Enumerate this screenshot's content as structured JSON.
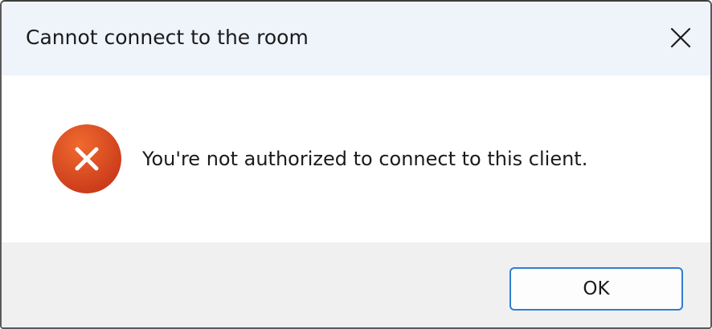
{
  "dialog": {
    "title": "Cannot connect to the room",
    "message": "You're not authorized to connect to this client.",
    "icon": "error-icon",
    "ok_label": "OK",
    "close_icon": "close-icon"
  },
  "colors": {
    "titlebar_bg": "#eff3fa",
    "footer_bg": "#f0f0f0",
    "error_red": "#d9481d",
    "button_focus_border": "#2f7fd1"
  }
}
